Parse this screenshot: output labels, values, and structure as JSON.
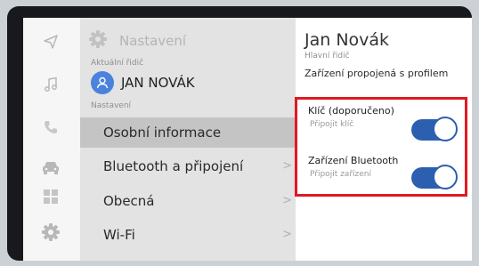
{
  "settings": {
    "title": "Nastavení",
    "current_driver_label": "Aktuální řidič",
    "section_label": "Nastavení"
  },
  "driver": {
    "name": "JAN NOVÁK"
  },
  "menu": {
    "items": [
      {
        "label": "Osobní informace",
        "active": true
      },
      {
        "label": "Bluetooth a připojení",
        "chevron": ">"
      },
      {
        "label": "Obecná",
        "chevron": ">"
      },
      {
        "label": "Wi-Fi",
        "chevron": ">"
      }
    ]
  },
  "profile": {
    "name": "Jan Novák",
    "role": "Hlavní řidič",
    "devices_note": "Zařízení propojená s profilem"
  },
  "options": [
    {
      "title": "Klíč (doporučeno)",
      "subtitle": "Připojit klíč",
      "enabled": true
    },
    {
      "title": "Zařízení Bluetooth",
      "subtitle": "Připojit zařízení",
      "enabled": true
    }
  ],
  "rail": {
    "icons": [
      "navigation-icon",
      "music-icon",
      "phone-icon",
      "car-icon",
      "apps-icon",
      "settings-icon"
    ]
  },
  "colors": {
    "accent": "#2d5fb0",
    "avatar": "#4a82dc",
    "highlight_border": "#e01822",
    "active_row": "#c4c4c4"
  }
}
